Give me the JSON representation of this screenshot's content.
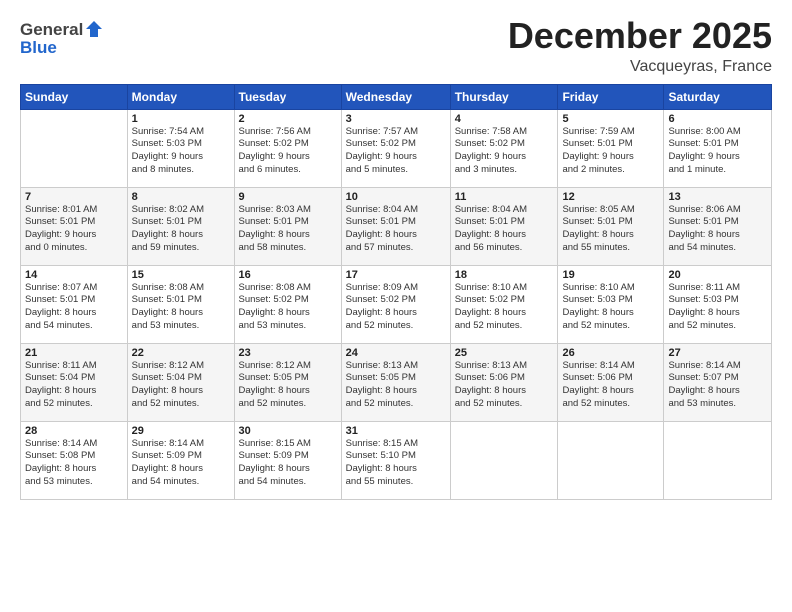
{
  "header": {
    "logo_general": "General",
    "logo_blue": "Blue",
    "month_title": "December 2025",
    "subtitle": "Vacqueyras, France"
  },
  "calendar": {
    "weekdays": [
      "Sunday",
      "Monday",
      "Tuesday",
      "Wednesday",
      "Thursday",
      "Friday",
      "Saturday"
    ],
    "weeks": [
      [
        {
          "day": "",
          "info": ""
        },
        {
          "day": "1",
          "info": "Sunrise: 7:54 AM\nSunset: 5:03 PM\nDaylight: 9 hours\nand 8 minutes."
        },
        {
          "day": "2",
          "info": "Sunrise: 7:56 AM\nSunset: 5:02 PM\nDaylight: 9 hours\nand 6 minutes."
        },
        {
          "day": "3",
          "info": "Sunrise: 7:57 AM\nSunset: 5:02 PM\nDaylight: 9 hours\nand 5 minutes."
        },
        {
          "day": "4",
          "info": "Sunrise: 7:58 AM\nSunset: 5:02 PM\nDaylight: 9 hours\nand 3 minutes."
        },
        {
          "day": "5",
          "info": "Sunrise: 7:59 AM\nSunset: 5:01 PM\nDaylight: 9 hours\nand 2 minutes."
        },
        {
          "day": "6",
          "info": "Sunrise: 8:00 AM\nSunset: 5:01 PM\nDaylight: 9 hours\nand 1 minute."
        }
      ],
      [
        {
          "day": "7",
          "info": "Sunrise: 8:01 AM\nSunset: 5:01 PM\nDaylight: 9 hours\nand 0 minutes."
        },
        {
          "day": "8",
          "info": "Sunrise: 8:02 AM\nSunset: 5:01 PM\nDaylight: 8 hours\nand 59 minutes."
        },
        {
          "day": "9",
          "info": "Sunrise: 8:03 AM\nSunset: 5:01 PM\nDaylight: 8 hours\nand 58 minutes."
        },
        {
          "day": "10",
          "info": "Sunrise: 8:04 AM\nSunset: 5:01 PM\nDaylight: 8 hours\nand 57 minutes."
        },
        {
          "day": "11",
          "info": "Sunrise: 8:04 AM\nSunset: 5:01 PM\nDaylight: 8 hours\nand 56 minutes."
        },
        {
          "day": "12",
          "info": "Sunrise: 8:05 AM\nSunset: 5:01 PM\nDaylight: 8 hours\nand 55 minutes."
        },
        {
          "day": "13",
          "info": "Sunrise: 8:06 AM\nSunset: 5:01 PM\nDaylight: 8 hours\nand 54 minutes."
        }
      ],
      [
        {
          "day": "14",
          "info": "Sunrise: 8:07 AM\nSunset: 5:01 PM\nDaylight: 8 hours\nand 54 minutes."
        },
        {
          "day": "15",
          "info": "Sunrise: 8:08 AM\nSunset: 5:01 PM\nDaylight: 8 hours\nand 53 minutes."
        },
        {
          "day": "16",
          "info": "Sunrise: 8:08 AM\nSunset: 5:02 PM\nDaylight: 8 hours\nand 53 minutes."
        },
        {
          "day": "17",
          "info": "Sunrise: 8:09 AM\nSunset: 5:02 PM\nDaylight: 8 hours\nand 52 minutes."
        },
        {
          "day": "18",
          "info": "Sunrise: 8:10 AM\nSunset: 5:02 PM\nDaylight: 8 hours\nand 52 minutes."
        },
        {
          "day": "19",
          "info": "Sunrise: 8:10 AM\nSunset: 5:03 PM\nDaylight: 8 hours\nand 52 minutes."
        },
        {
          "day": "20",
          "info": "Sunrise: 8:11 AM\nSunset: 5:03 PM\nDaylight: 8 hours\nand 52 minutes."
        }
      ],
      [
        {
          "day": "21",
          "info": "Sunrise: 8:11 AM\nSunset: 5:04 PM\nDaylight: 8 hours\nand 52 minutes."
        },
        {
          "day": "22",
          "info": "Sunrise: 8:12 AM\nSunset: 5:04 PM\nDaylight: 8 hours\nand 52 minutes."
        },
        {
          "day": "23",
          "info": "Sunrise: 8:12 AM\nSunset: 5:05 PM\nDaylight: 8 hours\nand 52 minutes."
        },
        {
          "day": "24",
          "info": "Sunrise: 8:13 AM\nSunset: 5:05 PM\nDaylight: 8 hours\nand 52 minutes."
        },
        {
          "day": "25",
          "info": "Sunrise: 8:13 AM\nSunset: 5:06 PM\nDaylight: 8 hours\nand 52 minutes."
        },
        {
          "day": "26",
          "info": "Sunrise: 8:14 AM\nSunset: 5:06 PM\nDaylight: 8 hours\nand 52 minutes."
        },
        {
          "day": "27",
          "info": "Sunrise: 8:14 AM\nSunset: 5:07 PM\nDaylight: 8 hours\nand 53 minutes."
        }
      ],
      [
        {
          "day": "28",
          "info": "Sunrise: 8:14 AM\nSunset: 5:08 PM\nDaylight: 8 hours\nand 53 minutes."
        },
        {
          "day": "29",
          "info": "Sunrise: 8:14 AM\nSunset: 5:09 PM\nDaylight: 8 hours\nand 54 minutes."
        },
        {
          "day": "30",
          "info": "Sunrise: 8:15 AM\nSunset: 5:09 PM\nDaylight: 8 hours\nand 54 minutes."
        },
        {
          "day": "31",
          "info": "Sunrise: 8:15 AM\nSunset: 5:10 PM\nDaylight: 8 hours\nand 55 minutes."
        },
        {
          "day": "",
          "info": ""
        },
        {
          "day": "",
          "info": ""
        },
        {
          "day": "",
          "info": ""
        }
      ]
    ]
  }
}
